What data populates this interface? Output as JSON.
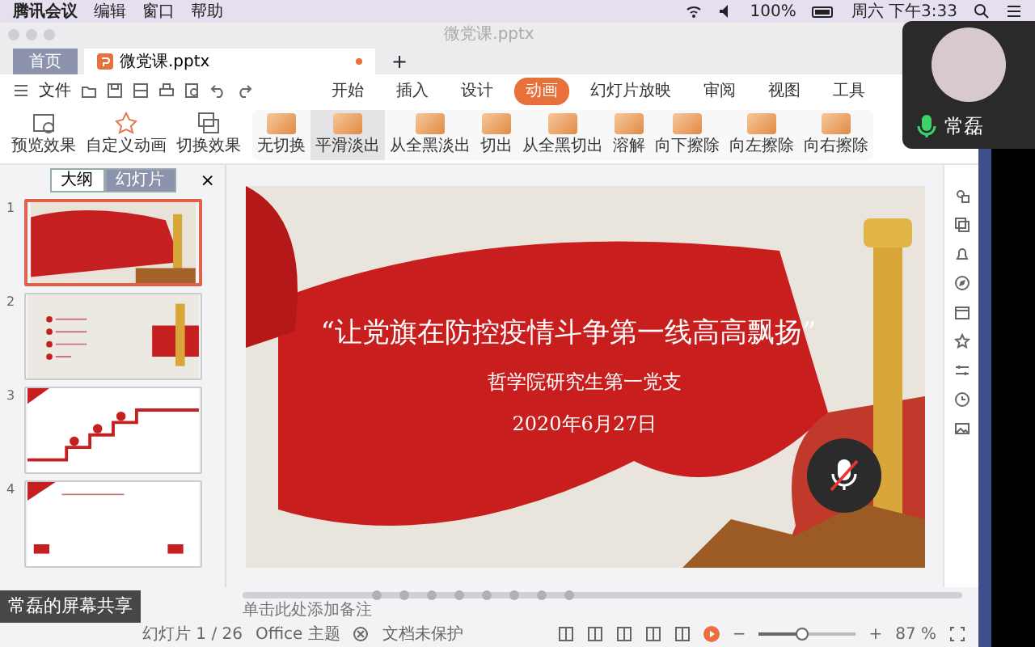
{
  "menubar": {
    "app": "腾讯会议",
    "menus": [
      "编辑",
      "窗口",
      "帮助"
    ],
    "battery": "100%",
    "clock": "周六 下午3:33"
  },
  "window": {
    "title": "微党课.pptx"
  },
  "tabs": [
    {
      "label": "首页",
      "kind": "home",
      "selected": false
    },
    {
      "label": "微党课.pptx",
      "kind": "document",
      "selected": true
    }
  ],
  "new_tab": "+",
  "file_menu": "文件",
  "ribbon_tabs": [
    {
      "label": "开始",
      "selected": false
    },
    {
      "label": "插入",
      "selected": false
    },
    {
      "label": "设计",
      "selected": false
    },
    {
      "label": "动画",
      "selected": true
    },
    {
      "label": "幻灯片放映",
      "selected": false
    },
    {
      "label": "审阅",
      "selected": false
    },
    {
      "label": "视图",
      "selected": false
    },
    {
      "label": "工具",
      "selected": false
    }
  ],
  "ribbon_actions": [
    "预览效果",
    "自定义动画",
    "切换效果"
  ],
  "transitions": [
    {
      "label": "无切换",
      "selected": false
    },
    {
      "label": "平滑淡出",
      "selected": true
    },
    {
      "label": "从全黑淡出",
      "selected": false
    },
    {
      "label": "切出",
      "selected": false
    },
    {
      "label": "从全黑切出",
      "selected": false
    },
    {
      "label": "溶解",
      "selected": false
    },
    {
      "label": "向下擦除",
      "selected": false
    },
    {
      "label": "向左擦除",
      "selected": false
    },
    {
      "label": "向右擦除",
      "selected": false
    }
  ],
  "panel": {
    "views": [
      {
        "label": "大纲",
        "selected": false
      },
      {
        "label": "幻灯片",
        "selected": true
      }
    ],
    "close": "×"
  },
  "thumbnails": [
    {
      "number": "1",
      "selected": true
    },
    {
      "number": "2",
      "selected": false
    },
    {
      "number": "3",
      "selected": false
    },
    {
      "number": "4",
      "selected": false
    }
  ],
  "slide": {
    "title": "“让党旗在防控疫情斗争第一线高高飘扬”",
    "subtitle": "哲学院研究生第一党支",
    "date": "2020年6月27日"
  },
  "notes_placeholder": "单击此处添加备注",
  "status_bar": {
    "slide_counter": "幻灯片 1 / 26",
    "theme": "Office 主题",
    "protection": "文档未保护",
    "zoom": {
      "minus": "−",
      "level": 0.45,
      "plus": "+",
      "reading": "87 %"
    }
  },
  "participant": {
    "name": "常磊",
    "mic_on": true
  },
  "mic_overlay": {
    "muted": true
  },
  "share_label": "常磊的屏幕共享"
}
